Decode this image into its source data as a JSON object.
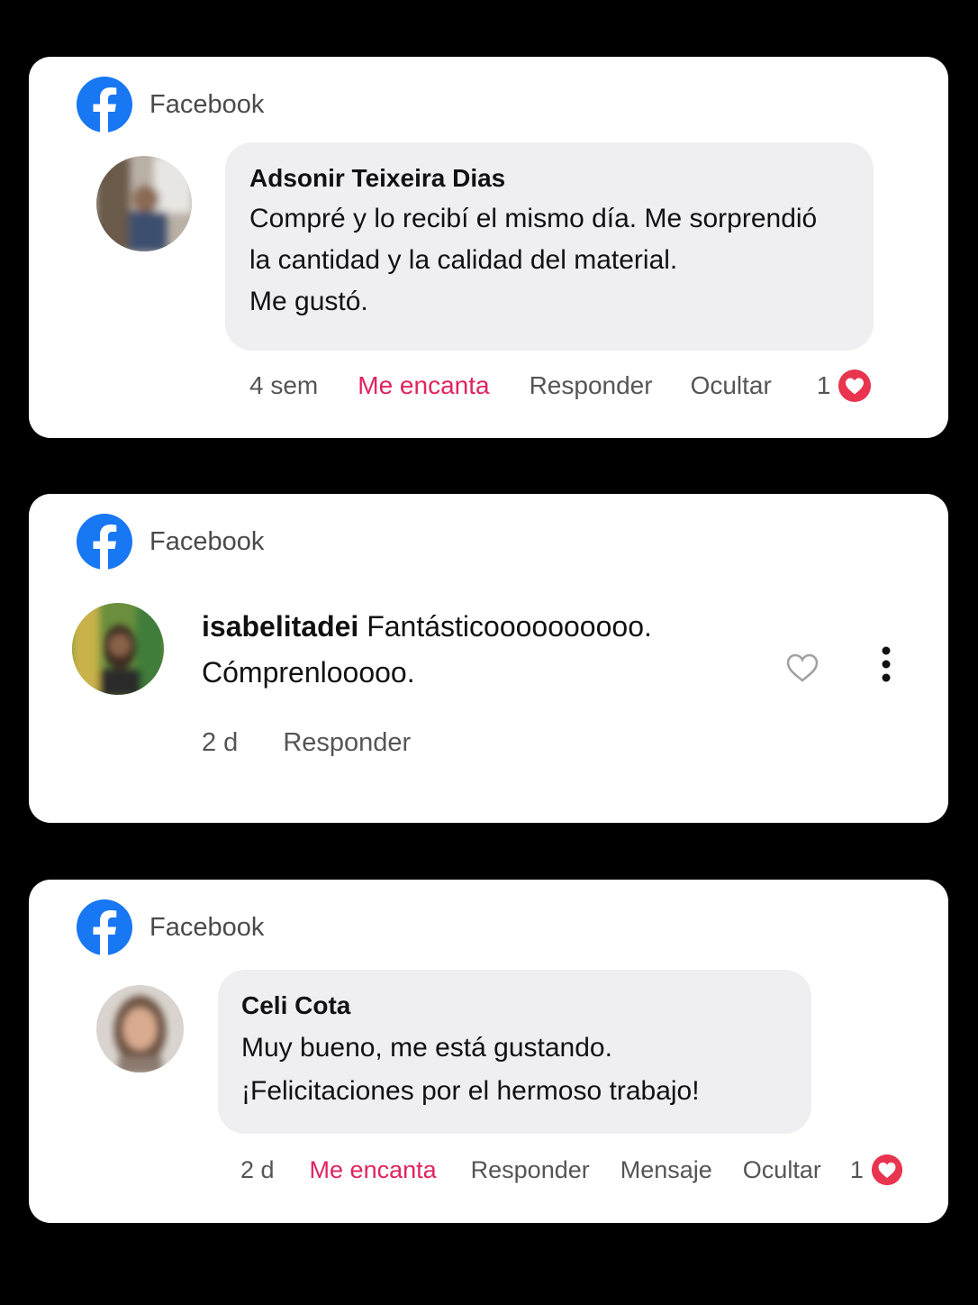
{
  "cards": [
    {
      "brand": {
        "label": "Facebook",
        "icon": "facebook-logo-icon",
        "color": "#1877f2"
      },
      "author": "Adsonir Teixeira Dias",
      "comment_lines": [
        "Compré y lo recibí el mismo día. Me sorprendió",
        "la cantidad y la calidad del material.",
        "Me gustó."
      ],
      "actions": {
        "time": "4 sem",
        "love": "Me encanta",
        "reply": "Responder",
        "hide": "Ocultar",
        "reaction_count": "1"
      }
    },
    {
      "brand": {
        "label": "Facebook",
        "icon": "facebook-logo-icon",
        "color": "#1877f2"
      },
      "author": "isabelitadei",
      "comment_lines": [
        "Fantásticoooooooooo.",
        "Cómprenlooooo."
      ],
      "actions": {
        "time": "2 d",
        "reply": "Responder"
      }
    },
    {
      "brand": {
        "label": "Facebook",
        "icon": "facebook-logo-icon",
        "color": "#1877f2"
      },
      "author": "Celi Cota",
      "comment_lines": [
        "Muy bueno, me está gustando.",
        "¡Felicitaciones por el hermoso trabajo!"
      ],
      "actions": {
        "time": "2 d",
        "love": "Me encanta",
        "reply": "Responder",
        "message": "Mensaje",
        "hide": "Ocultar",
        "reaction_count": "1"
      }
    }
  ],
  "colors": {
    "love": "#e0245e",
    "bubble": "#efeff2",
    "facebook_blue": "#1877f2"
  }
}
